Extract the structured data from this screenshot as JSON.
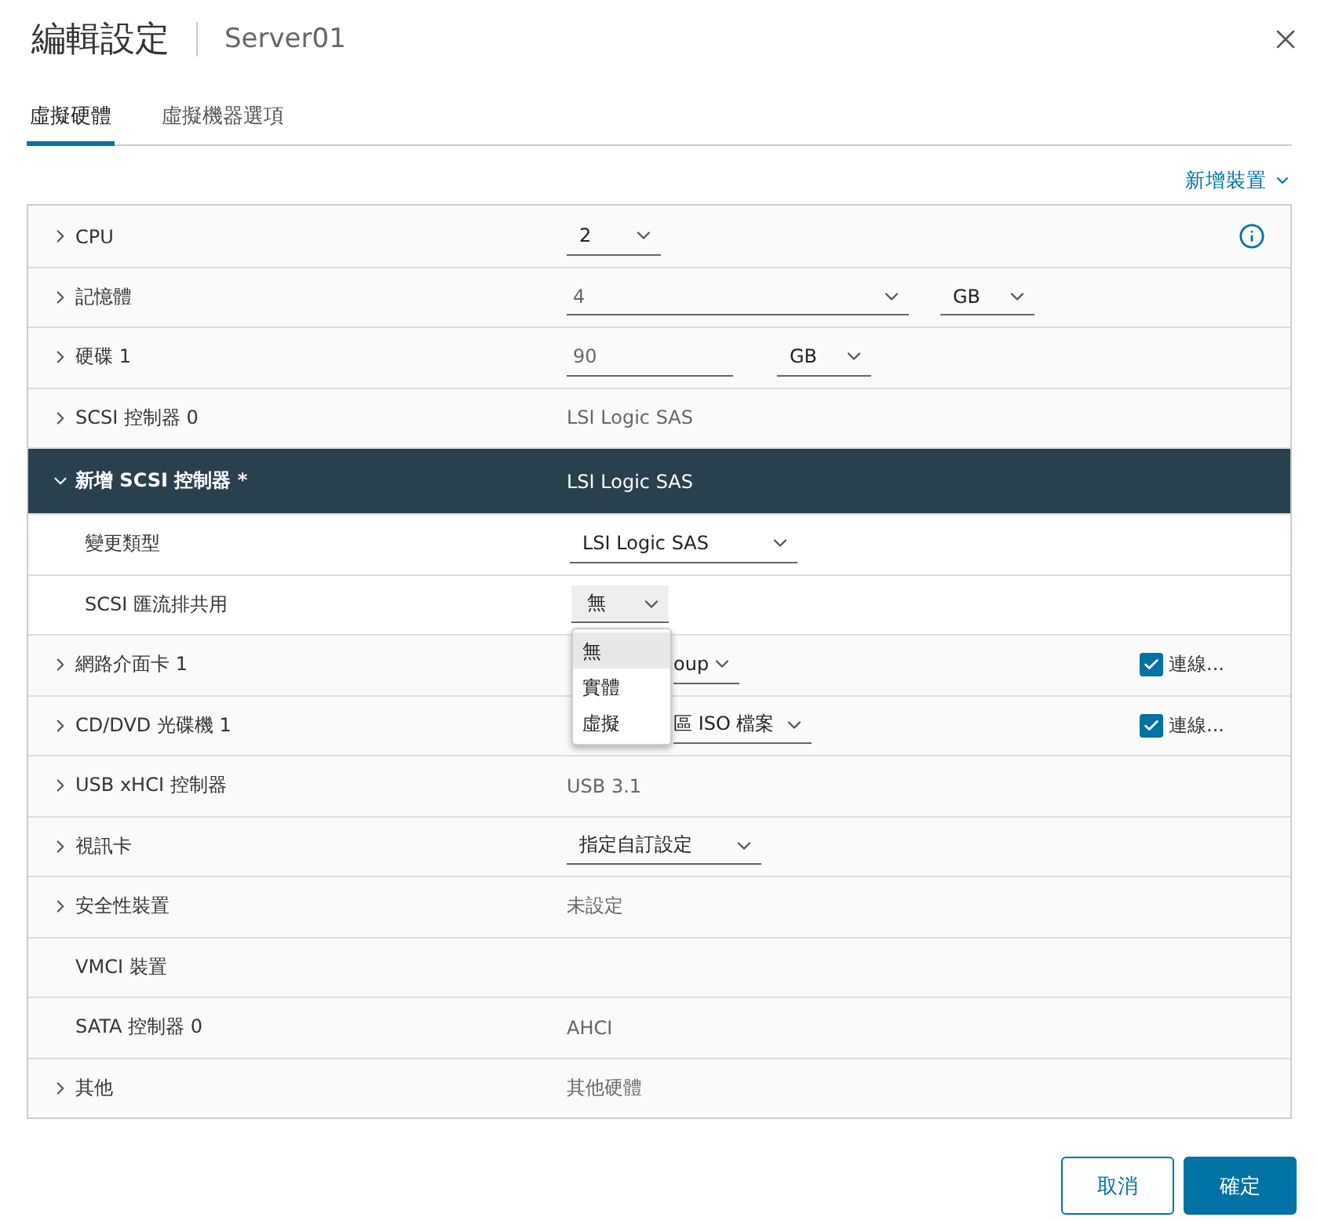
{
  "dialog": {
    "title": "編輯設定",
    "subtitle": "Server01"
  },
  "tabs": [
    {
      "label": "虛擬硬體",
      "selected": true
    },
    {
      "label": "虛擬機器選項",
      "selected": false
    }
  ],
  "add_device": "新增裝置",
  "devices": [
    {
      "kind": "select",
      "label": "CPU",
      "expandable": true,
      "expanded": false,
      "value": "2",
      "info": true
    },
    {
      "kind": "combo-unit",
      "label": "記憶體",
      "expandable": true,
      "expanded": false,
      "value": "4",
      "unit": "GB"
    },
    {
      "kind": "input-unit",
      "label": "硬碟 1",
      "expandable": true,
      "expanded": false,
      "value": "90",
      "unit": "GB"
    },
    {
      "kind": "text",
      "label": "SCSI 控制器 0",
      "expandable": true,
      "expanded": false,
      "value": "LSI Logic SAS"
    },
    {
      "kind": "text",
      "label": "新增 SCSI 控制器 *",
      "expandable": true,
      "expanded": true,
      "value": "LSI Logic SAS",
      "children": [
        {
          "kind": "select",
          "label": "變更類型",
          "value": "LSI Logic SAS"
        },
        {
          "kind": "menu",
          "label": "SCSI 匯流排共用",
          "value": "無",
          "options": [
            {
              "label": "無",
              "selected": true
            },
            {
              "label": "實體",
              "selected": false
            },
            {
              "label": "虛擬",
              "selected": false
            }
          ]
        }
      ]
    },
    {
      "kind": "select-connect",
      "label": "網路介面卡 1",
      "expandable": true,
      "expanded": false,
      "value": "oup",
      "connected": true,
      "connect_label": "連線..."
    },
    {
      "kind": "select-connect",
      "label": "CD/DVD 光碟機 1",
      "expandable": true,
      "expanded": false,
      "value": "區 ISO 檔案",
      "connected": true,
      "connect_label": "連線..."
    },
    {
      "kind": "text",
      "label": "USB xHCI 控制器",
      "expandable": true,
      "expanded": false,
      "value": "USB 3.1"
    },
    {
      "kind": "select",
      "label": "視訊卡",
      "expandable": true,
      "expanded": false,
      "value": "指定自訂設定"
    },
    {
      "kind": "text",
      "label": "安全性裝置",
      "expandable": true,
      "expanded": false,
      "value": "未設定"
    },
    {
      "kind": "text",
      "label": "VMCI 裝置",
      "expandable": false,
      "expanded": false
    },
    {
      "kind": "text",
      "label": "SATA 控制器 0",
      "expandable": false,
      "expanded": false,
      "value": "AHCI"
    },
    {
      "kind": "text",
      "label": "其他",
      "expandable": true,
      "expanded": false,
      "value": "其他硬體"
    }
  ],
  "buttons": [
    {
      "label": "取消",
      "kind": "secondary"
    },
    {
      "label": "確定",
      "kind": "primary"
    }
  ]
}
